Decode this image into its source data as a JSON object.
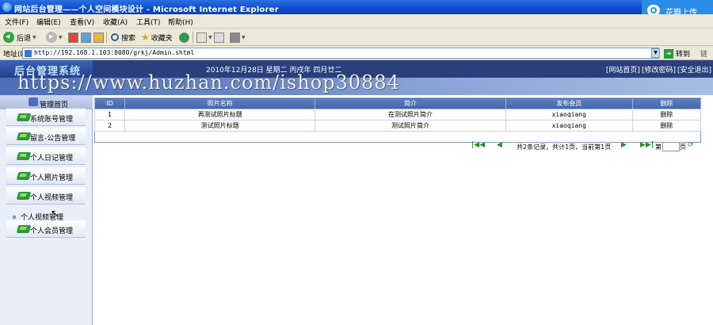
{
  "window": {
    "title": "网站后台管理——个人空间模块设计 - Microsoft Internet Explorer",
    "huaban_label": "花瓣上传"
  },
  "menu": [
    "文件(F)",
    "编辑(E)",
    "查看(V)",
    "收藏(A)",
    "工具(T)",
    "帮助(H)"
  ],
  "toolbar": {
    "back_label": "后退",
    "search_label": "搜索",
    "favorites_label": "收藏夹"
  },
  "address": {
    "label": "地址(D)",
    "url": "http://192.168.1.103:8080/grkj/Admin.shtml",
    "go_label": "转到",
    "links_label": "链接"
  },
  "header": {
    "logo": "后台管理系统",
    "date": "2010年12月28日 星期二 丙戌年 四月廿二",
    "links": [
      "[网站首页]",
      "[修改密码]",
      "[安全退出]"
    ]
  },
  "watermark": "https://www.huzhan.com/ishop30884",
  "sidebar": {
    "home": "管理首页",
    "items": [
      "系统账号管理",
      "留言-公告管理",
      "个人日记管理",
      "个人照片管理",
      "个人视频管理"
    ],
    "sub_item": "个人视频管理",
    "last_item": "个人会员管理"
  },
  "table": {
    "headers": [
      "ID",
      "照片名称",
      "简介",
      "发布会员",
      "删除"
    ],
    "rows": [
      [
        "1",
        "再测试照片标题",
        "在测试照片简介",
        "xiaoqiang",
        "删除"
      ],
      [
        "2",
        "测试照片标题",
        "测试照片简介",
        "xiaoqiang",
        "删除"
      ]
    ]
  },
  "pager": {
    "summary": "共2条记录，共计1页，当前第1页",
    "page_prefix": "第",
    "page_suffix": "页"
  }
}
